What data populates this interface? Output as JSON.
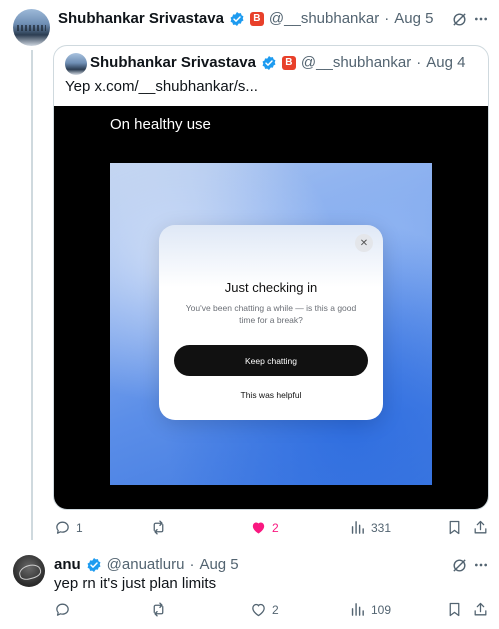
{
  "post": {
    "author_name": "Shubhankar Srivastava",
    "handle": "@__shubhankar",
    "separator": "·",
    "date": "Aug 5",
    "quote": {
      "author_name": "Shubhankar Srivastava",
      "handle": "@__shubhankar",
      "separator": "·",
      "date": "Aug 4",
      "text": "Yep  x.com/__shubhankar/s...",
      "media": {
        "title": "On healthy use",
        "dialog": {
          "close": "✕",
          "title": "Just checking in",
          "body": "You've been chatting a while — is this a good time for a break?",
          "primary_button": "Keep chatting",
          "secondary_button": "This was helpful"
        }
      }
    },
    "actions": {
      "replies": "1",
      "reposts": "",
      "likes": "2",
      "views": "331"
    }
  },
  "reply": {
    "author_name": "anu",
    "handle": "@anuatluru",
    "separator": "·",
    "date": "Aug 5",
    "text": "yep rn it's just plan limits",
    "actions": {
      "replies": "",
      "reposts": "",
      "likes": "2",
      "views": "109"
    }
  },
  "colors": {
    "verified": "#1d9bf0",
    "liked": "#f91880",
    "badge": "#e8402a",
    "muted": "#536471"
  }
}
